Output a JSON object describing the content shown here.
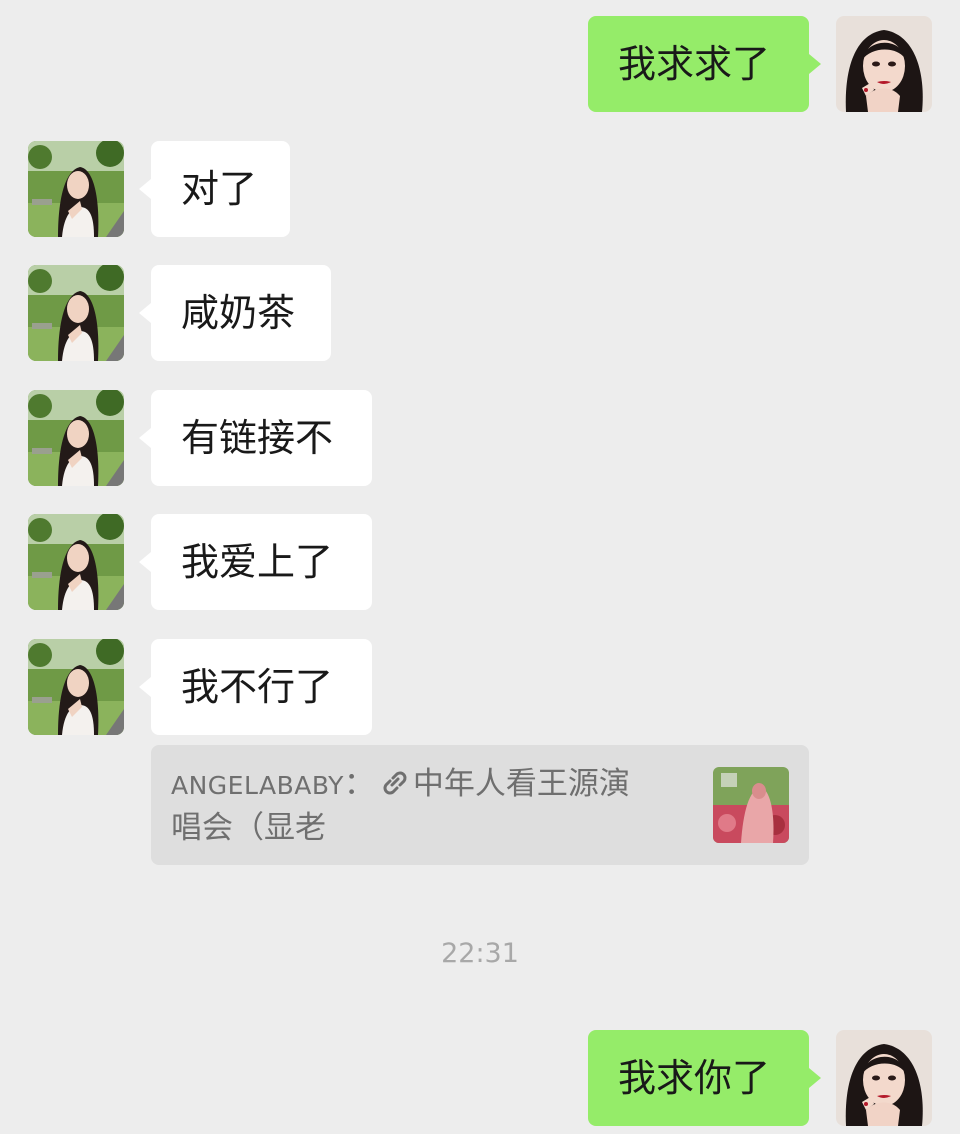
{
  "messages": [
    {
      "side": "out",
      "text": "我求求了"
    },
    {
      "side": "in",
      "text": "对了"
    },
    {
      "side": "in",
      "text": "咸奶茶"
    },
    {
      "side": "in",
      "text": "有链接不"
    },
    {
      "side": "in",
      "text": "我爱上了"
    },
    {
      "side": "in",
      "text": "我不行了"
    },
    {
      "side": "out",
      "text": "我求你了"
    }
  ],
  "quote": {
    "author": "ANGELABABY",
    "separator": "：",
    "line1": "中年人看王源演",
    "line2": "唱会（显老",
    "icon": "link-icon"
  },
  "timestamp": "22:31",
  "colors": {
    "background": "#ededed",
    "outgoing_bubble": "#95ec69",
    "incoming_bubble": "#ffffff",
    "quote_background": "#dedede"
  }
}
